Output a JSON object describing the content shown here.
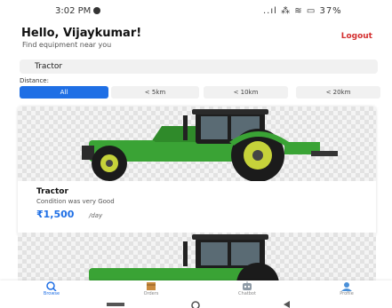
{
  "status": {
    "time": "3:02 PM",
    "icons": "..ıl ⁂ ≋ ▭ 37%"
  },
  "header": {
    "greeting": "Hello, Vijaykumar!",
    "subtitle": "Find equipment near you",
    "logout": "Logout"
  },
  "search": {
    "value": "Tractor"
  },
  "filters": {
    "label": "Distance:",
    "options": [
      "All",
      "< 5km",
      "< 10km",
      "< 20km"
    ],
    "selected": "All"
  },
  "listings": [
    {
      "title": "Tractor",
      "description": "Condition was very Good",
      "price": "₹1,500",
      "unit": "/day"
    }
  ],
  "nav": {
    "items": [
      "Browse",
      "Orders",
      "Chatbot",
      "Profile"
    ],
    "active": "Browse"
  },
  "colors": {
    "accent": "#1f6fe5",
    "logout": "#d32f2f",
    "tractor_green": "#3aa335"
  }
}
